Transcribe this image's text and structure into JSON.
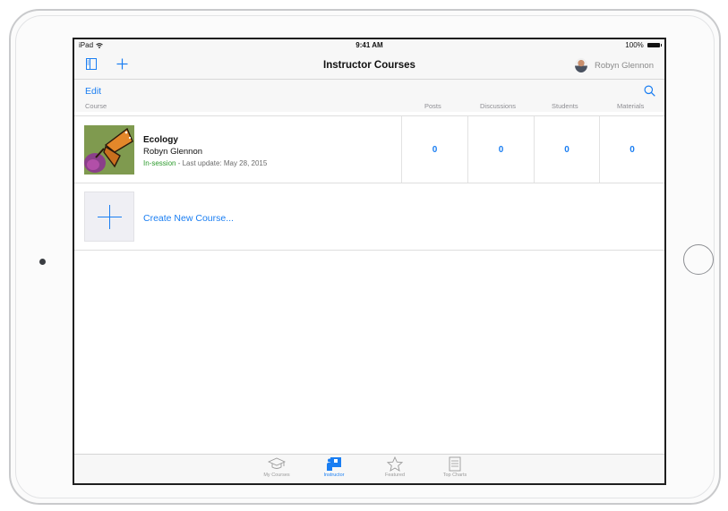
{
  "status_bar": {
    "device": "iPad",
    "time": "9:41 AM",
    "battery": "100%"
  },
  "nav": {
    "title": "Instructor Courses",
    "user_name": "Robyn Glennon"
  },
  "toolbar": {
    "edit_label": "Edit"
  },
  "table": {
    "columns": {
      "course": "Course",
      "posts": "Posts",
      "discussions": "Discussions",
      "students": "Students",
      "materials": "Materials"
    },
    "rows": [
      {
        "title": "Ecology",
        "instructor": "Robyn Glennon",
        "status": "In-session",
        "update": " - Last update: May 28, 2015",
        "posts": "0",
        "discussions": "0",
        "students": "0",
        "materials": "0"
      }
    ],
    "create_label": "Create New Course..."
  },
  "tabs": [
    {
      "label": "My Courses",
      "icon": "graduation-cap-icon"
    },
    {
      "label": "Instructor",
      "icon": "instructor-icon"
    },
    {
      "label": "Featured",
      "icon": "star-icon"
    },
    {
      "label": "Top Charts",
      "icon": "list-icon"
    }
  ],
  "colors": {
    "accent": "#1a7ef2",
    "status_green": "#2b9a2b"
  }
}
